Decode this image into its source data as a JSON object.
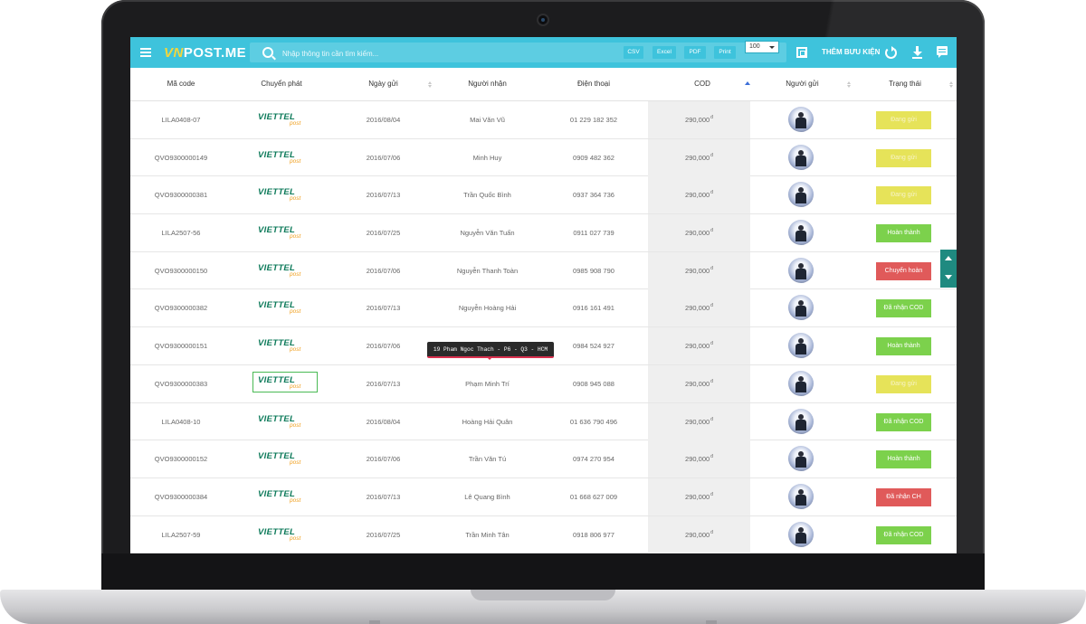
{
  "app": {
    "logo_text_a": "VN",
    "logo_text_b": "POST.ME"
  },
  "search": {
    "placeholder": "Nhập thông tin cần tìm kiếm..."
  },
  "toolbar": {
    "csv_label": "CSV",
    "excel_label": "Excel",
    "pdf_label": "PDF",
    "print_label": "Print",
    "page_size": "100",
    "add_label": "THÊM BƯU KIỆN",
    "icons": [
      "menu-icon",
      "search-icon",
      "fullscreen-icon",
      "refresh-icon",
      "download-icon",
      "chat-icon"
    ]
  },
  "table": {
    "headers": {
      "code": "Mã code",
      "carrier": "Chuyển phát",
      "date": "Ngày gửi",
      "recipient": "Người nhận",
      "phone": "Điện thoại",
      "cod": "COD",
      "sender": "Người gửi",
      "status": "Trạng thái"
    },
    "carrier_logo": "VIETTEL",
    "carrier_sub": "post",
    "rows": [
      {
        "code": "LILA0408-07",
        "date": "2016/08/04",
        "recipient": "Mai Văn Vũ",
        "phone": "01 229 182 352",
        "cod": "290,000",
        "cod_unit": "đ",
        "status": "Đang gửi",
        "status_type": "yellow"
      },
      {
        "code": "QVO9300000149",
        "date": "2016/07/06",
        "recipient": "Minh Huy",
        "phone": "0909 482 362",
        "cod": "290,000",
        "cod_unit": "đ",
        "status": "Đang gửi",
        "status_type": "yellow"
      },
      {
        "code": "QVO9300000381",
        "date": "2016/07/13",
        "recipient": "Trần Quốc Bình",
        "phone": "0937 364 736",
        "cod": "290,000",
        "cod_unit": "đ",
        "status": "Đang gửi",
        "status_type": "yellow"
      },
      {
        "code": "LILA2507-56",
        "date": "2016/07/25",
        "recipient": "Nguyễn Văn Tuấn",
        "phone": "0911 027 739",
        "cod": "290,000",
        "cod_unit": "đ",
        "status": "Hoàn thành",
        "status_type": "green"
      },
      {
        "code": "QVO9300000150",
        "date": "2016/07/06",
        "recipient": "Nguyễn Thanh Toàn",
        "phone": "0985 908 790",
        "cod": "290,000",
        "cod_unit": "đ",
        "status": "Chuyển hoàn",
        "status_type": "red"
      },
      {
        "code": "QVO9300000382",
        "date": "2016/07/13",
        "recipient": "Nguyễn Hoàng Hải",
        "phone": "0916 161 491",
        "cod": "290,000",
        "cod_unit": "đ",
        "status": "Đã nhận COD",
        "status_type": "green"
      },
      {
        "code": "QVO9300000151",
        "date": "2016/07/06",
        "recipient": "",
        "phone": "0984 524 927",
        "cod": "290,000",
        "cod_unit": "đ",
        "status": "Hoàn thành",
        "status_type": "green"
      },
      {
        "code": "QVO9300000383",
        "date": "2016/07/13",
        "recipient": "Phạm Minh Trí",
        "phone": "0908 945 088",
        "cod": "290,000",
        "cod_unit": "đ",
        "status": "Đang gửi",
        "status_type": "yellow"
      },
      {
        "code": "LILA0408-10",
        "date": "2016/08/04",
        "recipient": "Hoàng Hải Quân",
        "phone": "01 636 790 496",
        "cod": "290,000",
        "cod_unit": "đ",
        "status": "Đã nhận COD",
        "status_type": "green"
      },
      {
        "code": "QVO9300000152",
        "date": "2016/07/06",
        "recipient": "Trần Văn Tú",
        "phone": "0974 270 954",
        "cod": "290,000",
        "cod_unit": "đ",
        "status": "Hoàn thành",
        "status_type": "green"
      },
      {
        "code": "QVO9300000384",
        "date": "2016/07/13",
        "recipient": "Lê Quang Bình",
        "phone": "01 668 627 009",
        "cod": "290,000",
        "cod_unit": "đ",
        "status": "Đã nhận CH",
        "status_type": "red"
      },
      {
        "code": "LILA2507-59",
        "date": "2016/07/25",
        "recipient": "Trần Minh Tân",
        "phone": "0918 806 977",
        "cod": "290,000",
        "cod_unit": "đ",
        "status": "Đã nhận COD",
        "status_type": "green"
      }
    ]
  },
  "tooltip": {
    "text": "19 Pham Ngoc Thach - P6 - Q3 - HCM"
  },
  "colors": {
    "topbar": "#3ec3dc",
    "status_yellow": "#e6e359",
    "status_green": "#7cd14c",
    "status_red": "#e05a5a",
    "scroll_control": "#1f8a80"
  }
}
